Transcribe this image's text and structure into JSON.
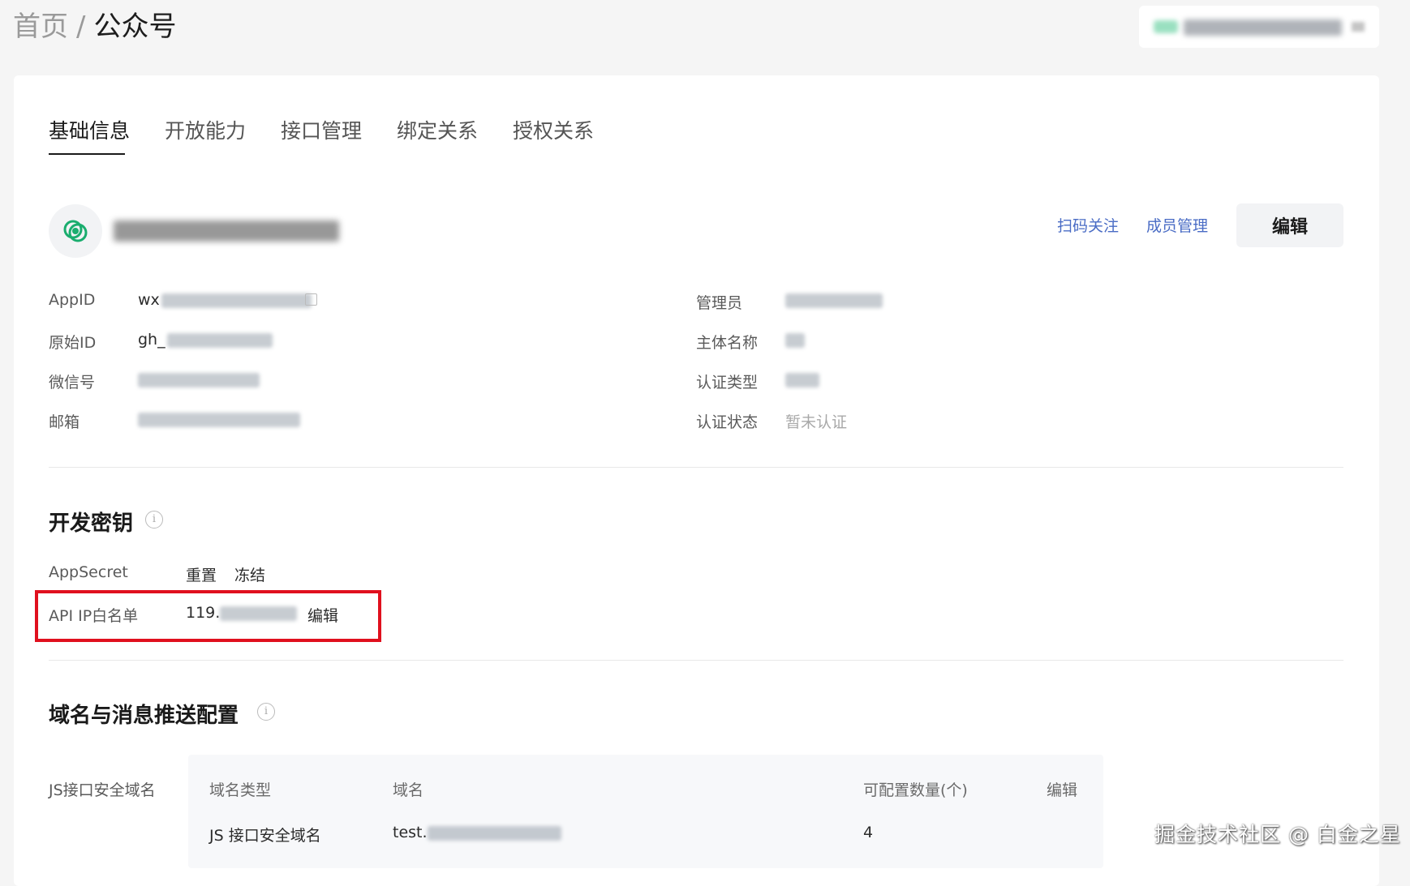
{
  "breadcrumb": {
    "home": "首页",
    "separator": "/",
    "current": "公众号"
  },
  "tabs": [
    "基础信息",
    "开放能力",
    "接口管理",
    "绑定关系",
    "授权关系"
  ],
  "profile": {
    "actions": {
      "scan_follow": "扫码关注",
      "members": "成员管理",
      "edit": "编辑"
    }
  },
  "info_left": [
    {
      "label": "AppID",
      "value_prefix": "wx"
    },
    {
      "label": "原始ID",
      "value_prefix": "gh_"
    },
    {
      "label": "微信号",
      "value_prefix": ""
    },
    {
      "label": "邮箱",
      "value_prefix": ""
    }
  ],
  "info_right": [
    {
      "label": "管理员",
      "value": ""
    },
    {
      "label": "主体名称",
      "value": ""
    },
    {
      "label": "认证类型",
      "value": ""
    },
    {
      "label": "认证状态",
      "value": "暂未认证"
    }
  ],
  "dev_key": {
    "title": "开发密钥",
    "secret_label": "AppSecret",
    "reset": "重置",
    "freeze": "冻结",
    "ip_label": "API IP白名单",
    "ip_prefix": "119.",
    "ip_edit": "编辑"
  },
  "domain": {
    "title": "域名与消息推送配置",
    "row_label": "JS接口安全域名",
    "headers": {
      "type": "域名类型",
      "domain": "域名",
      "count": "可配置数量(个)",
      "edit": "编辑"
    },
    "row": {
      "type": "JS 接口安全域名",
      "domain_prefix": "test.",
      "count": "4"
    }
  },
  "watermark": "掘金技术社区 @ 白金之星",
  "colors": {
    "link": "#4a6cc5",
    "highlight": "#e0101e",
    "wechat_green": "#1aad6e"
  }
}
